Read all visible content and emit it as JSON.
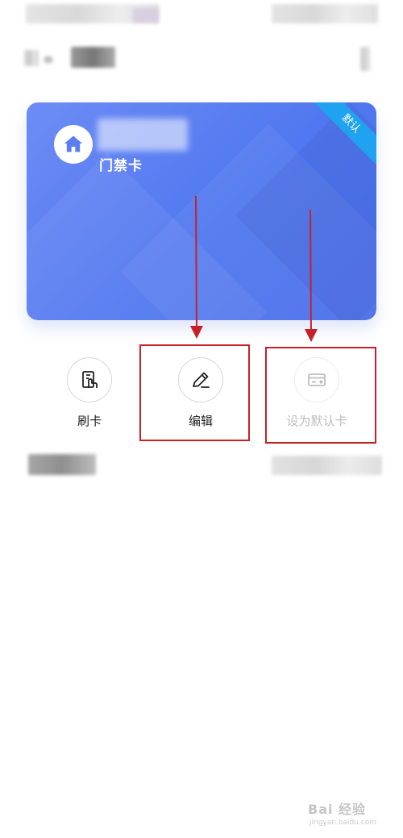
{
  "card": {
    "type_label": "门禁卡",
    "ribbon_label": "默认"
  },
  "actions": [
    {
      "label": "刷卡"
    },
    {
      "label": "编辑"
    },
    {
      "label": "设为默认卡"
    }
  ],
  "watermark": {
    "logo": "Bai 经验",
    "url": "jingyan.baidu.com"
  },
  "colors": {
    "card_start": "#6d8cf5",
    "card_end": "#4a6ee8",
    "ribbon": "#1fa2ef",
    "highlight": "#c8202a",
    "disabled_text": "#bdbdbd"
  },
  "icons": [
    "home-icon",
    "card-swipe-icon",
    "pencil-icon",
    "card-icon"
  ]
}
